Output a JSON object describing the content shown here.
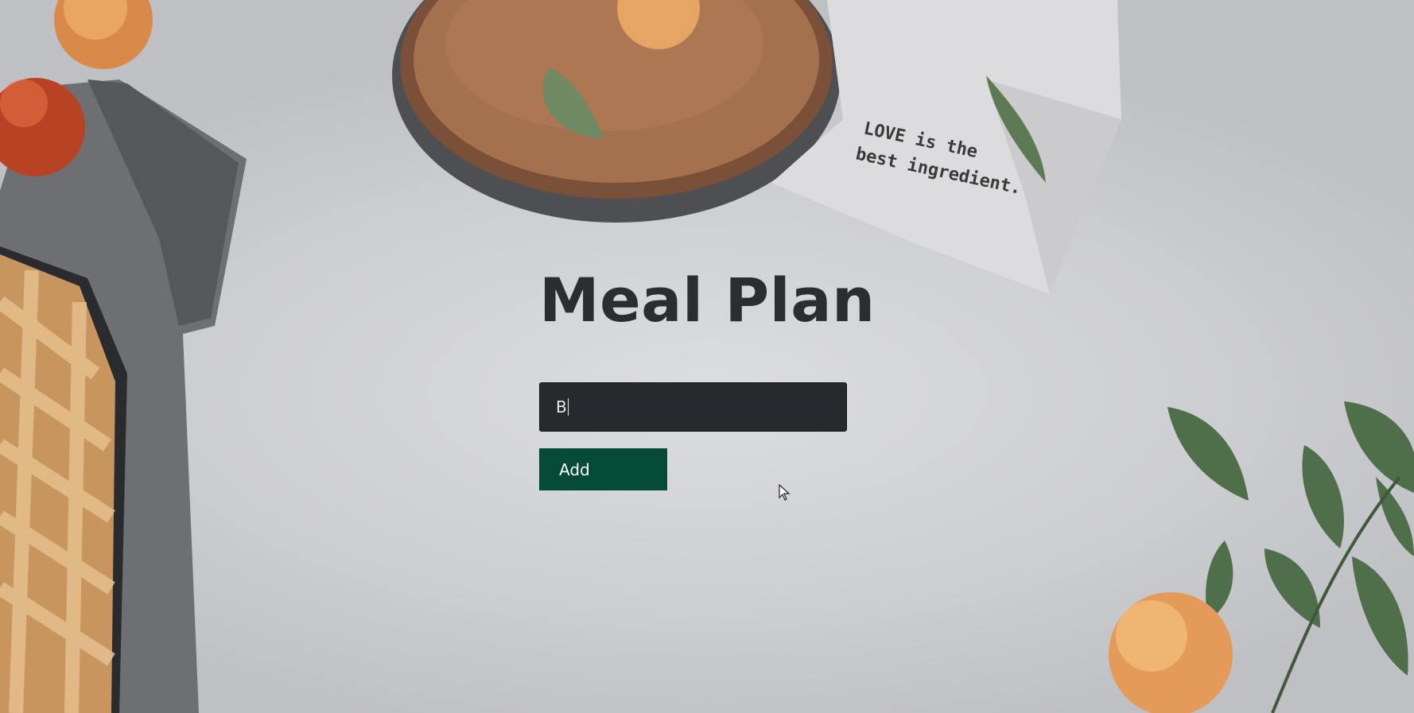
{
  "page": {
    "title": "Meal Plan"
  },
  "form": {
    "input_value": "B",
    "add_label": "Add"
  },
  "background": {
    "napkin_text_line1": "LOVE is the",
    "napkin_text_line2": "best ingredient."
  },
  "colors": {
    "button": "#044a37",
    "input": "#26292d",
    "title": "#2b2d30"
  }
}
